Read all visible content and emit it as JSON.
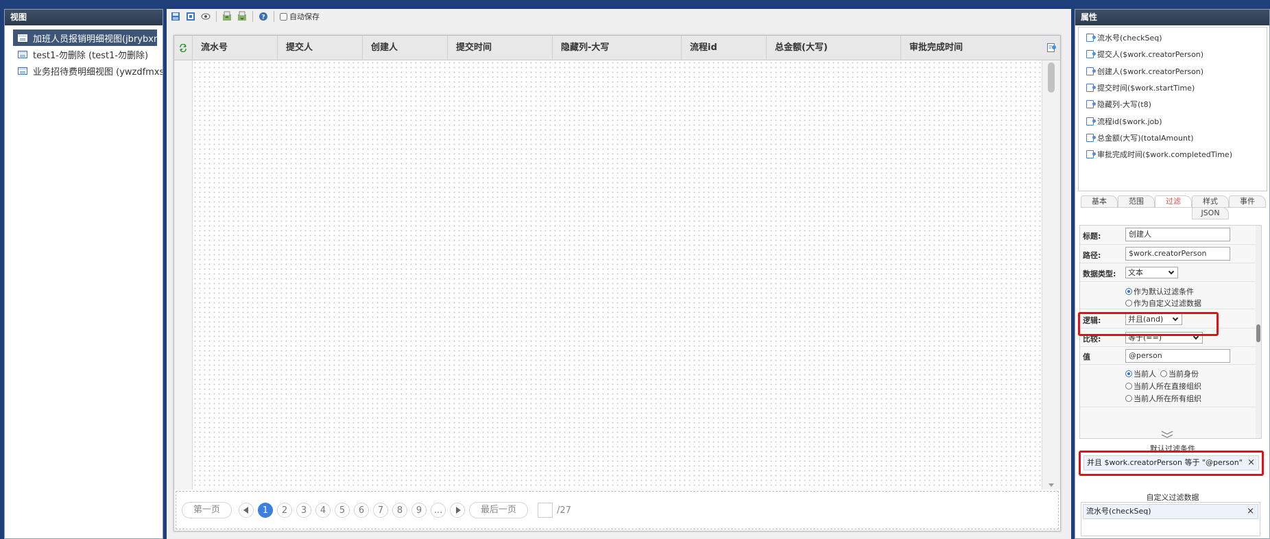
{
  "left_panel": {
    "title": "视图",
    "items": [
      {
        "label": "加班人员报销明细视图(jbrybxm",
        "selected": true
      },
      {
        "label": "test1-勿删除 (test1-勿删除)",
        "selected": false
      },
      {
        "label": "业务招待费明细视图 (ywzdfmxst)",
        "selected": false
      }
    ]
  },
  "toolbar": {
    "icons": [
      "save-icon",
      "save-as-icon",
      "preview-icon",
      "import-icon",
      "export-icon",
      "help-icon"
    ],
    "autosave_label": "自动保存"
  },
  "grid": {
    "columns": [
      "流水号",
      "提交人",
      "创建人",
      "提交时间",
      "隐藏列-大写",
      "流程id",
      "总金额(大写)",
      "审批完成时间"
    ]
  },
  "pager": {
    "first": "第一页",
    "last": "最后一页",
    "pages": [
      "1",
      "2",
      "3",
      "4",
      "5",
      "6",
      "7",
      "8",
      "9",
      "..."
    ],
    "current_page": "1",
    "total": "/27"
  },
  "right_panel": {
    "title": "属性",
    "fields": [
      "流水号(checkSeq)",
      "提交人($work.creatorPerson)",
      "创建人($work.creatorPerson)",
      "提交时间($work.startTime)",
      "隐藏列-大写(t8)",
      "流程id($work.job)",
      "总金额(大写)(totalAmount)",
      "审批完成时间($work.completedTime)"
    ],
    "tabs": [
      "基本",
      "范围",
      "过滤",
      "样式",
      "事件",
      "JSON"
    ],
    "active_tab": "过滤",
    "props": {
      "title_label": "标题:",
      "title_value": "创建人",
      "path_label": "路径:",
      "path_value": "$work.creatorPerson",
      "datatype_label": "数据类型:",
      "datatype_value": "文本",
      "mode_default": "作为默认过滤条件",
      "mode_custom": "作为自定义过滤数据",
      "logic_label": "逻辑:",
      "logic_value": "并且(and)",
      "compare_label": "比较:",
      "compare_value": "等于(==)",
      "value_label": "值",
      "value_value": "@person",
      "opt_current_person": "当前人",
      "opt_current_identity": "当前身份",
      "opt_direct_org": "当前人所在直接组织",
      "opt_all_org": "当前人所在所有组织"
    },
    "default_filter_title": "默认过滤条件",
    "default_filter_entry": "并且 $work.creatorPerson 等于 \"@person\"",
    "custom_filter_title": "自定义过滤数据",
    "custom_filter_entry": "流水号(checkSeq)",
    "remove_label": "×"
  },
  "colors": {
    "accent_blue": "#3d7fdc",
    "highlight_red": "#e3101a",
    "panel_header": "#2b3a4f"
  }
}
